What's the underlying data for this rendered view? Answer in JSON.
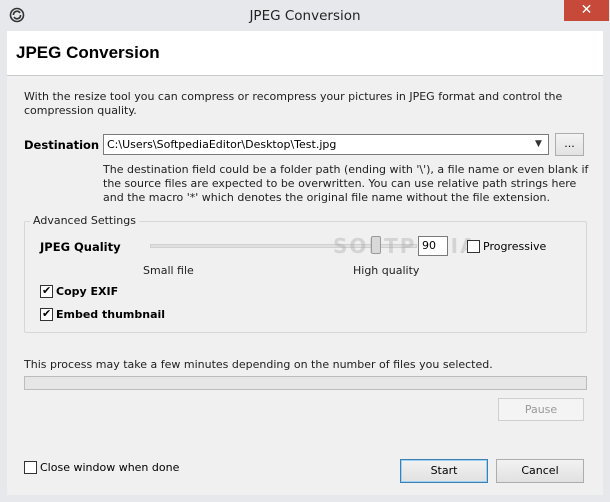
{
  "window": {
    "title": "JPEG Conversion",
    "close_symbol": "✕",
    "icon": "app-icon"
  },
  "header": {
    "title": "JPEG Conversion"
  },
  "intro_text": "With the resize tool you can compress or recompress your pictures in JPEG format and control the compression quality.",
  "destination": {
    "label": "Destination",
    "value": "C:\\Users\\SoftpediaEditor\\Desktop\\Test.jpg",
    "browse_label": "...",
    "help_text": "The destination field could be a folder path (ending with '\\'), a file name or even blank if the source files are expected to be overwritten. You can use relative path strings here and the macro '*' which denotes the original file name without the file extension."
  },
  "advanced": {
    "group_label": "Advanced Settings",
    "quality_label": "JPEG Quality",
    "quality_value": "90",
    "quality_fraction": 0.9,
    "small_file_label": "Small file",
    "high_quality_label": "High quality",
    "progressive_label": "Progressive",
    "progressive_checked": false,
    "copy_exif_label": "Copy EXIF",
    "copy_exif_checked": true,
    "embed_thumbnail_label": "Embed thumbnail",
    "embed_thumbnail_checked": true
  },
  "process": {
    "text": "This process may take a few minutes depending on the number of files you selected.",
    "progress": 0,
    "pause_label": "Pause"
  },
  "footer": {
    "close_when_done_label": "Close window when done",
    "close_when_done_checked": false,
    "start_label": "Start",
    "cancel_label": "Cancel"
  },
  "watermark": "SOFTPEDIA",
  "colors": {
    "close_button": "#c7493a",
    "progress": "#06b025"
  }
}
